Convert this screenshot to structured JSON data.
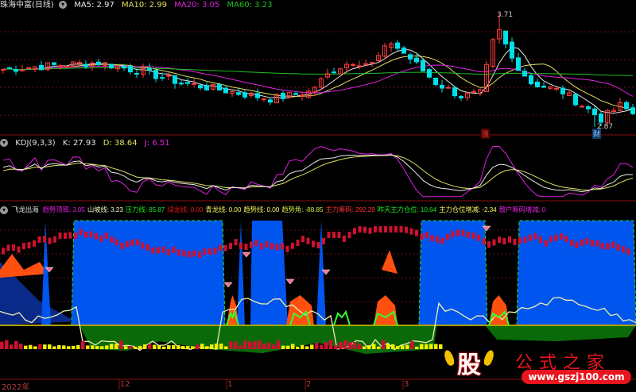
{
  "price_panel": {
    "title": "珠海中富(日线)",
    "ma5": "MA5: 2.97",
    "ma10": "MA10: 2.99",
    "ma20": "MA20: 3.05",
    "ma60": "MA60: 3.23",
    "high_label": "3.71",
    "low_label": "2.87",
    "marker_zhang": "涨",
    "marker_cai": "财",
    "closes": [
      [
        0,
        3.3
      ],
      [
        8,
        3.33
      ],
      [
        15,
        3.35
      ],
      [
        22,
        3.28
      ],
      [
        28,
        3.2
      ],
      [
        35,
        3.14
      ],
      [
        42,
        3.08
      ],
      [
        48,
        3.13
      ],
      [
        52,
        3.3
      ],
      [
        55,
        3.36
      ],
      [
        58,
        3.34
      ],
      [
        61,
        3.5
      ],
      [
        64,
        3.38
      ],
      [
        68,
        3.2
      ],
      [
        72,
        3.1
      ],
      [
        75,
        3.12
      ],
      [
        77,
        3.5
      ],
      [
        78,
        3.58
      ],
      [
        80,
        3.38
      ],
      [
        83,
        3.2
      ],
      [
        88,
        3.13
      ],
      [
        92,
        3.0
      ],
      [
        94,
        2.93
      ],
      [
        97,
        3.03
      ],
      [
        99,
        2.97
      ]
    ],
    "colors": {
      "up": "#ff3c3c",
      "down": "#00e0e8",
      "ma5": "#e8e8e8",
      "ma10": "#e0e060",
      "ma20": "#e020e0",
      "ma60": "#20c020"
    }
  },
  "kdj_panel": {
    "title": "KDJ(9,3,3)",
    "k": "K: 27.93",
    "d": "D: 38.64",
    "j": "J: 6.51"
  },
  "indicator_panel": {
    "title": "飞龙出海",
    "items": [
      {
        "label": "趋势顶底: 3.05",
        "color": "#e020e0"
      },
      {
        "label": "山坡线: 3.23",
        "color": "#f0f0c0"
      },
      {
        "label": "压力线: 85.87",
        "color": "#20e020"
      },
      {
        "label": "绿龙线: 0.00",
        "color": "#e01818"
      },
      {
        "label": "青龙线: 0.00",
        "color": "#f0f060"
      },
      {
        "label": "趋势线: 0.00",
        "color": "#f0f060"
      },
      {
        "label": "趋势角: -88.85",
        "color": "#d0e040"
      },
      {
        "label": "主力筹码: 292.29",
        "color": "#ff3030"
      },
      {
        "label": "昨天主力仓位: 10.64",
        "color": "#20e020"
      },
      {
        "label": "主力仓位增减: -2.34",
        "color": "#f0f060"
      },
      {
        "label": "散户筹码增减: 0",
        "color": "#e020e0"
      }
    ]
  },
  "time_axis": {
    "labels": [
      "2022年",
      "12",
      "1",
      "2",
      "3"
    ]
  },
  "watermark": {
    "logo_char": "股",
    "name": "公式之家",
    "url": "www.gszj100.com"
  }
}
